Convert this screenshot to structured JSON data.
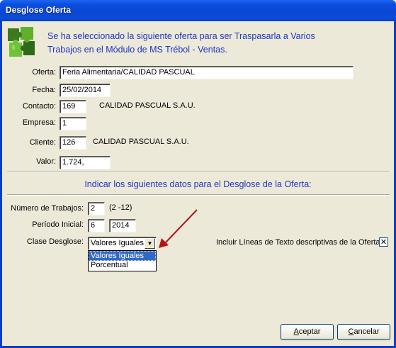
{
  "window": {
    "title": "Desglose Oferta"
  },
  "header": {
    "line1": "Se ha seleccionado la siguiente oferta para ser Traspasarla a Varios",
    "line2": "Trabajos en el Módulo de MS Trébol - Ventas."
  },
  "oferta": {
    "oferta_label": "Oferta:",
    "oferta_value": "Feria Alimentaria/CALIDAD PASCUAL",
    "fecha_label": "Fecha:",
    "fecha_value": "25/02/2014",
    "contacto_label": "Contacto:",
    "contacto_value": "169",
    "contacto_name": "CALIDAD PASCUAL S.A.U.",
    "empresa_label": "Empresa:",
    "empresa_value": "1",
    "cliente_label": "Cliente:",
    "cliente_value": "126",
    "cliente_name": "CALIDAD PASCUAL S.A.U.",
    "valor_label": "Valor:",
    "valor_value": "1.724,"
  },
  "desglose": {
    "section_title": "Indicar los siguientes datos para el Desglose de la Oferta:",
    "num_trabajos_label": "Número de Trabajos:",
    "num_trabajos_value": "2",
    "num_trabajos_hint": "(2 -12)",
    "periodo_label": "Período Inicial:",
    "periodo_month": "6",
    "periodo_year": "2014",
    "clase_label": "Clase Desglose:",
    "clase_selected": "Valores Iguales",
    "clase_options": [
      "Valores Iguales",
      "Porcentual"
    ],
    "incluir_label": "Incluir Líneas de Texto descriptivas de la Oferta",
    "incluir_checked": true
  },
  "buttons": {
    "accept_mnemonic": "A",
    "accept_rest": "ceptar",
    "cancel_mnemonic": "C",
    "cancel_rest": "ancelar"
  }
}
